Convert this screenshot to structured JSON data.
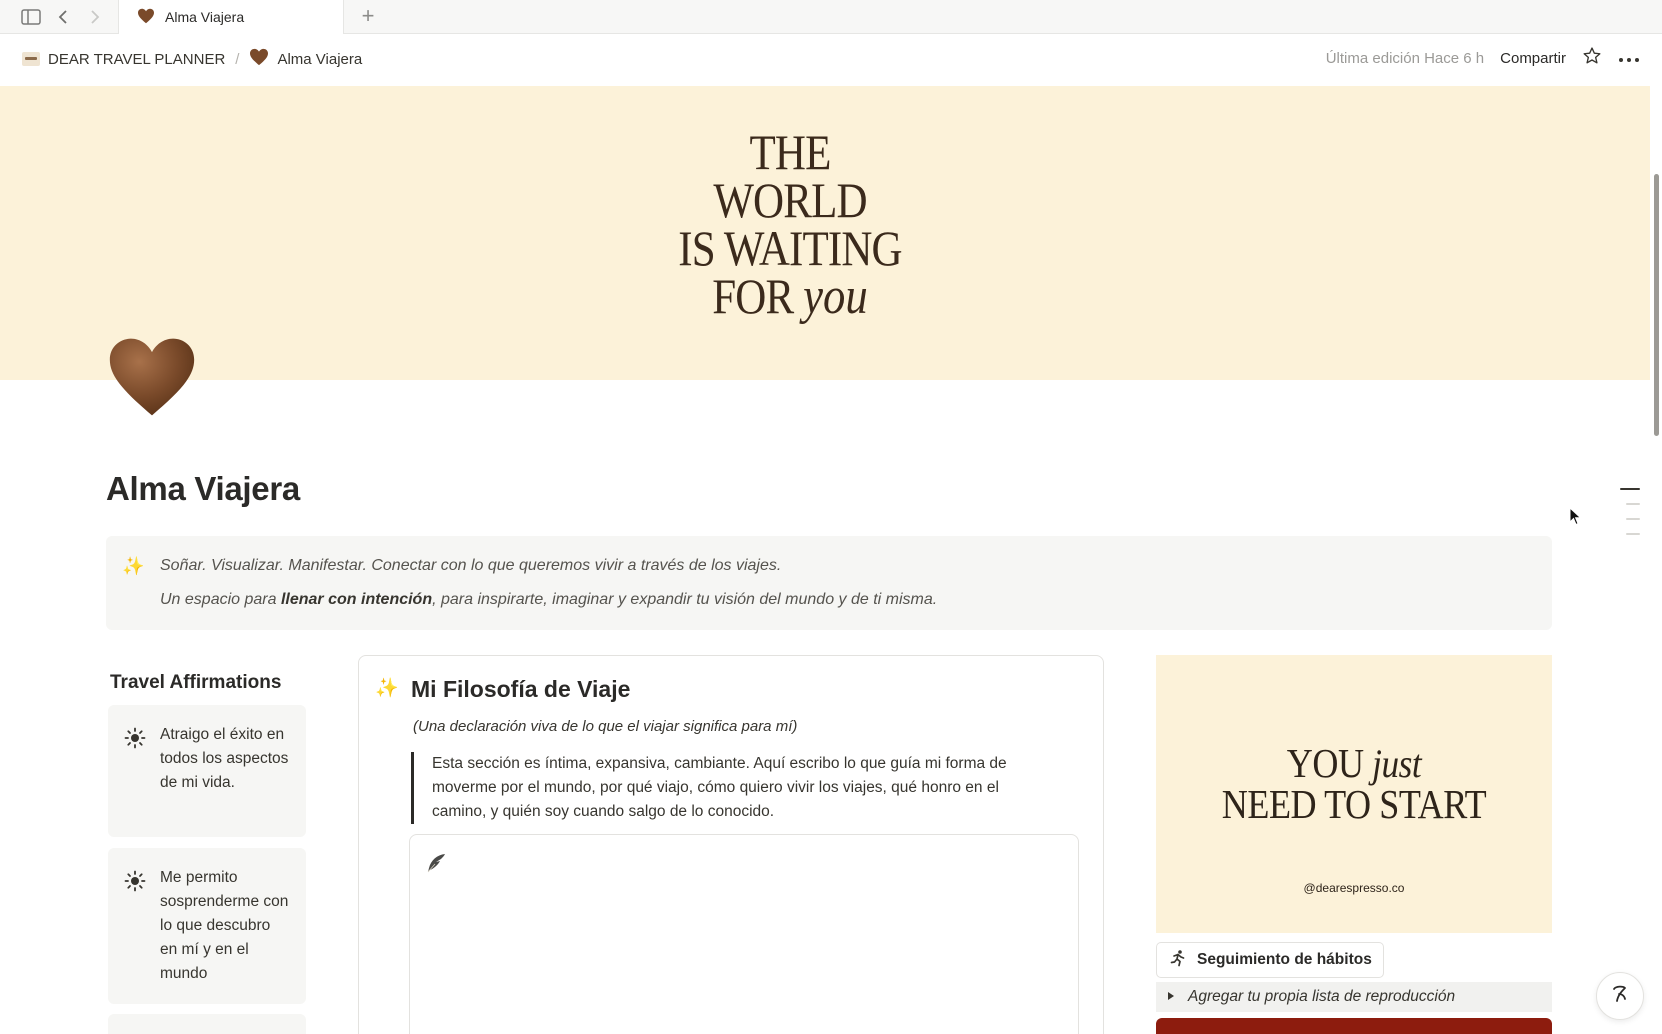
{
  "tab": {
    "icon": "brown-heart-icon",
    "label": "Alma Viajera"
  },
  "breadcrumb": {
    "workspace": "DEAR TRAVEL PLANNER",
    "separator": "/",
    "page": "Alma Viajera"
  },
  "header": {
    "last_edited": "Última edición Hace 6 h",
    "share_label": "Compartir"
  },
  "cover": {
    "line1": "THE",
    "line2": "WORLD",
    "line3": "IS WAITING",
    "line4": "FOR",
    "script": "you"
  },
  "page": {
    "title": "Alma Viajera"
  },
  "callout": {
    "line1": "Soñar. Visualizar. Manifestar. Conectar con lo que queremos vivir a través de los viajes.",
    "line2_pre": "Un espacio para ",
    "line2_bold": "llenar con intención",
    "line2_post": ", para inspirarte, imaginar y expandir tu visión del mundo y de ti misma."
  },
  "affirmations": {
    "title": "Travel Affirmations",
    "items": [
      {
        "text": "Atraigo el éxito en todos los aspectos de mi vida."
      },
      {
        "text": "Me permito sosprenderme con lo que descubro en mí y en el mundo"
      }
    ]
  },
  "philosophy": {
    "title": "Mi Filosofía de Viaje",
    "subtitle": "(Una declaración viva de lo que el viajar significa para mí)",
    "quote": "Esta sección es íntima, expansiva, cambiante. Aquí escribo lo que guía mi forma de moverme por el mundo, por qué viajo, cómo quiero vivir los viajes, qué honro en el camino, y quién soy cuando salgo de lo conocido."
  },
  "motivation": {
    "line1": "YOU",
    "script": "just",
    "line2": "NEED TO START",
    "handle": "@dearespresso.co"
  },
  "habit_button": {
    "label": "Seguimiento de hábitos"
  },
  "toggle": {
    "label": "Agregar tu propia lista de reproducción"
  },
  "colors": {
    "cover_bg": "#fcf2d9",
    "callout_bg": "#f6f6f4",
    "accent_red": "#8d1c0e",
    "heart_brown": "#7a4a2a"
  }
}
